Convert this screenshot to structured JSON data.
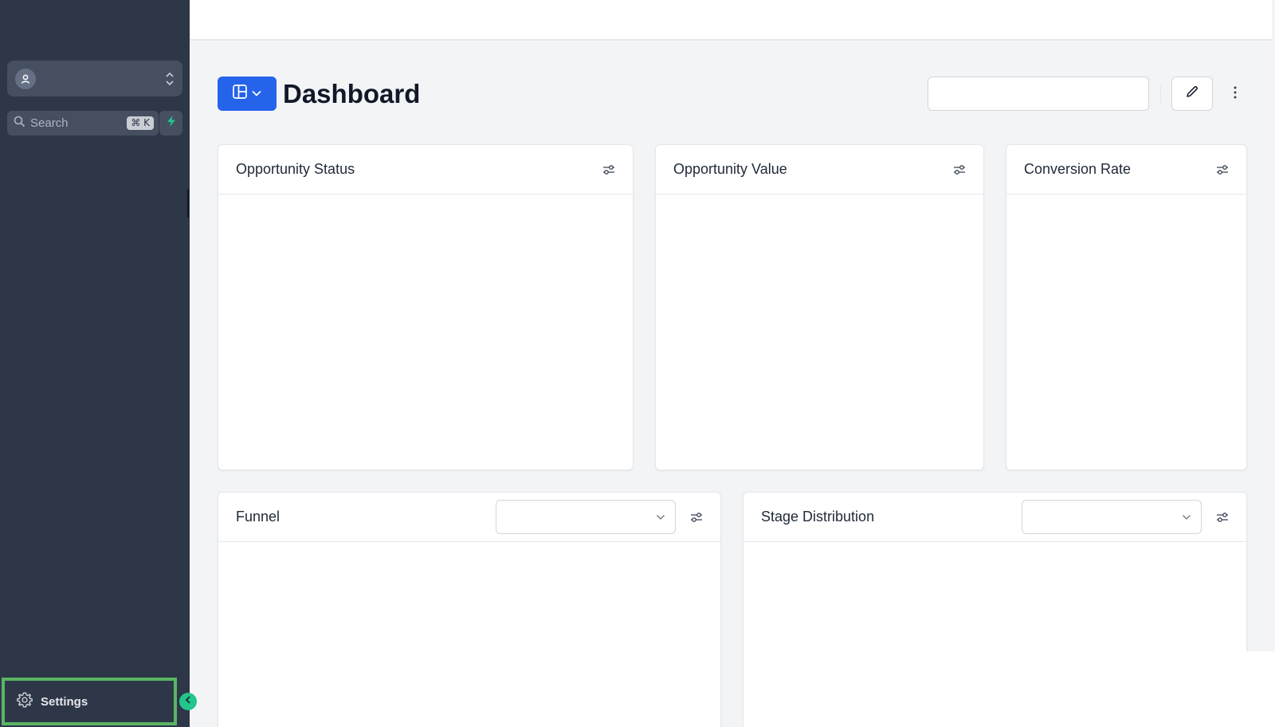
{
  "sidebar": {
    "search_label": "Search",
    "search_shortcut": "⌘ K",
    "settings_label": "Settings",
    "icons": [
      "user-icon",
      "chevron-up-down-icon",
      "search-icon",
      "bolt-icon",
      "gear-icon",
      "chevron-left-icon"
    ]
  },
  "header": {
    "title": "Dashboard",
    "icons": [
      "layout-icon",
      "chevron-down-icon",
      "pencil-icon",
      "more-vertical-icon"
    ]
  },
  "cards": [
    {
      "title": "Opportunity Status"
    },
    {
      "title": "Opportunity Value"
    },
    {
      "title": "Conversion Rate"
    },
    {
      "title": "Funnel"
    },
    {
      "title": "Stage Distribution"
    }
  ],
  "colors": {
    "sidebar_bg": "#2e3748",
    "accent": "#2563eb",
    "highlight": "#5ab563",
    "collapse_btn": "#22c58b",
    "bolt": "#22c58b"
  }
}
